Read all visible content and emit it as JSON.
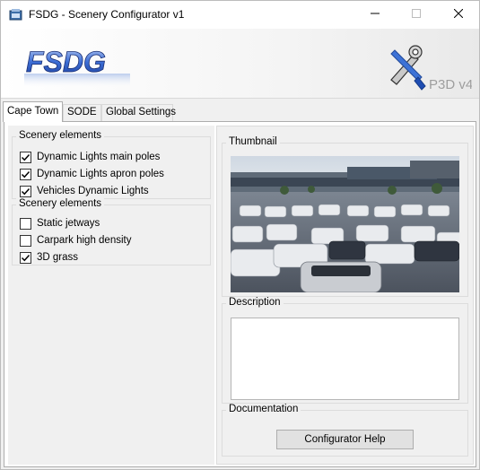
{
  "window": {
    "title": "FSDG - Scenery Configurator v1",
    "icons": [
      "app-icon",
      "minimize-icon",
      "maximize-icon",
      "close-icon"
    ]
  },
  "banner": {
    "left_logo_text": "FSDG",
    "right_logo_text": "P3D v4"
  },
  "tabs": [
    {
      "label": "Cape Town",
      "active": true
    },
    {
      "label": "SODE",
      "active": false
    },
    {
      "label": "Global Settings",
      "active": false
    }
  ],
  "groups": [
    {
      "title": "Scenery elements",
      "items": [
        {
          "label": "Dynamic Lights main poles",
          "checked": true
        },
        {
          "label": "Dynamic Lights apron poles",
          "checked": true
        },
        {
          "label": "Vehicles Dynamic Lights",
          "checked": true
        }
      ]
    },
    {
      "title": "Scenery elements",
      "items": [
        {
          "label": "Static jetways",
          "checked": false
        },
        {
          "label": "Carpark high density",
          "checked": false
        },
        {
          "label": "3D grass",
          "checked": true
        }
      ]
    }
  ],
  "thumbnail": {
    "title": "Thumbnail"
  },
  "description": {
    "title": "Description",
    "text": ""
  },
  "documentation": {
    "title": "Documentation",
    "button_label": "Configurator Help"
  }
}
